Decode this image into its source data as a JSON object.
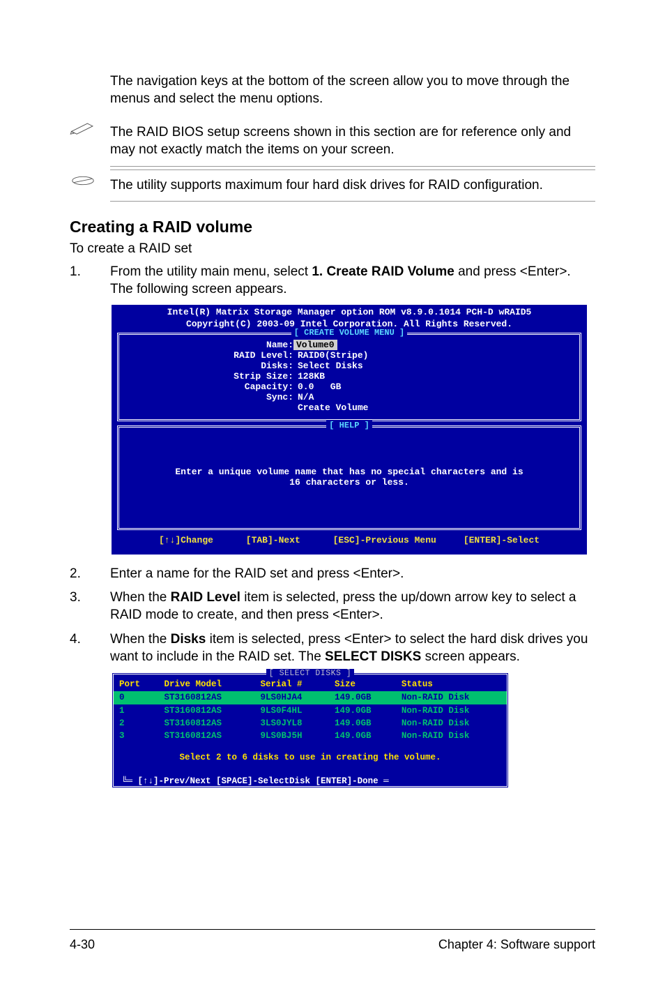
{
  "intro_para": "The navigation keys at the bottom of the screen allow you to move through the menus and select the menu options.",
  "notes": {
    "n1": "The RAID BIOS setup screens shown in this section are for reference only and may not exactly match the items on your screen.",
    "n2": "The utility supports maximum four hard disk drives for RAID configuration."
  },
  "section_heading": "Creating a RAID volume",
  "section_sub": "To create a RAID set",
  "steps": {
    "s1_num": "1.",
    "s1_a": "From the utility main menu, select ",
    "s1_bold": "1. Create RAID Volume",
    "s1_b": " and press <Enter>. The following screen appears.",
    "s2_num": "2.",
    "s2": "Enter a name for the RAID set and press <Enter>.",
    "s3_num": "3.",
    "s3_a": "When the ",
    "s3_bold": "RAID Level",
    "s3_b": " item is selected, press the up/down arrow key to select a RAID mode to create, and then press <Enter>.",
    "s4_num": "4.",
    "s4_a": "When the ",
    "s4_bold1": "Disks",
    "s4_b": " item is selected, press <Enter> to select the hard disk drives you want to include in the RAID set. The ",
    "s4_bold2": "SELECT DISKS",
    "s4_c": " screen appears."
  },
  "bios": {
    "hdr1": "Intel(R) Matrix Storage Manager option ROM v8.9.0.1014 PCH-D wRAID5",
    "hdr2": "Copyright(C) 2003-09 Intel Corporation.  All Rights Reserved.",
    "create_title": "[ CREATE VOLUME MENU ]",
    "labels": {
      "name": "Name:",
      "raid_level": "RAID Level:",
      "disks": "Disks:",
      "strip": "Strip Size:",
      "capacity": "Capacity:",
      "sync": "Sync:",
      "create": "Create Volume"
    },
    "values": {
      "name": "Volume0",
      "raid_level": "RAID0(Stripe)",
      "disks": "Select Disks",
      "strip": "128KB",
      "capacity": "0.0   GB",
      "sync": "N/A"
    },
    "help_title": "[ HELP ]",
    "help_line1": "Enter a unique volume name that has no special characters and is",
    "help_line2": "16 characters or less.",
    "nav": "[↑↓]Change      [TAB]-Next      [ESC]-Previous Menu     [ENTER]-Select"
  },
  "select_disks": {
    "title": "[ SELECT DISKS ]",
    "headers": {
      "port": "Port",
      "model": "Drive Model",
      "serial": "Serial #",
      "size": "Size",
      "status": "Status"
    },
    "rows": [
      {
        "port": "0",
        "model": "ST3160812AS",
        "serial": "9LS0HJA4",
        "size": "149.0GB",
        "status": "Non-RAID Disk",
        "hl": true
      },
      {
        "port": "1",
        "model": "ST3160812AS",
        "serial": "9LS0F4HL",
        "size": "149.0GB",
        "status": "Non-RAID Disk",
        "hl": false
      },
      {
        "port": "2",
        "model": "ST3160812AS",
        "serial": "3LS0JYL8",
        "size": "149.0GB",
        "status": "Non-RAID Disk",
        "hl": false
      },
      {
        "port": "3",
        "model": "ST3160812AS",
        "serial": "9LS0BJ5H",
        "size": "149.0GB",
        "status": "Non-RAID Disk",
        "hl": false
      }
    ],
    "msg": "Select 2 to 6 disks to use in creating the volume.",
    "nav": "[↑↓]-Prev/Next [SPACE]-SelectDisk [ENTER]-Done"
  },
  "footer": {
    "left": "4-30",
    "right": "Chapter 4: Software support"
  }
}
